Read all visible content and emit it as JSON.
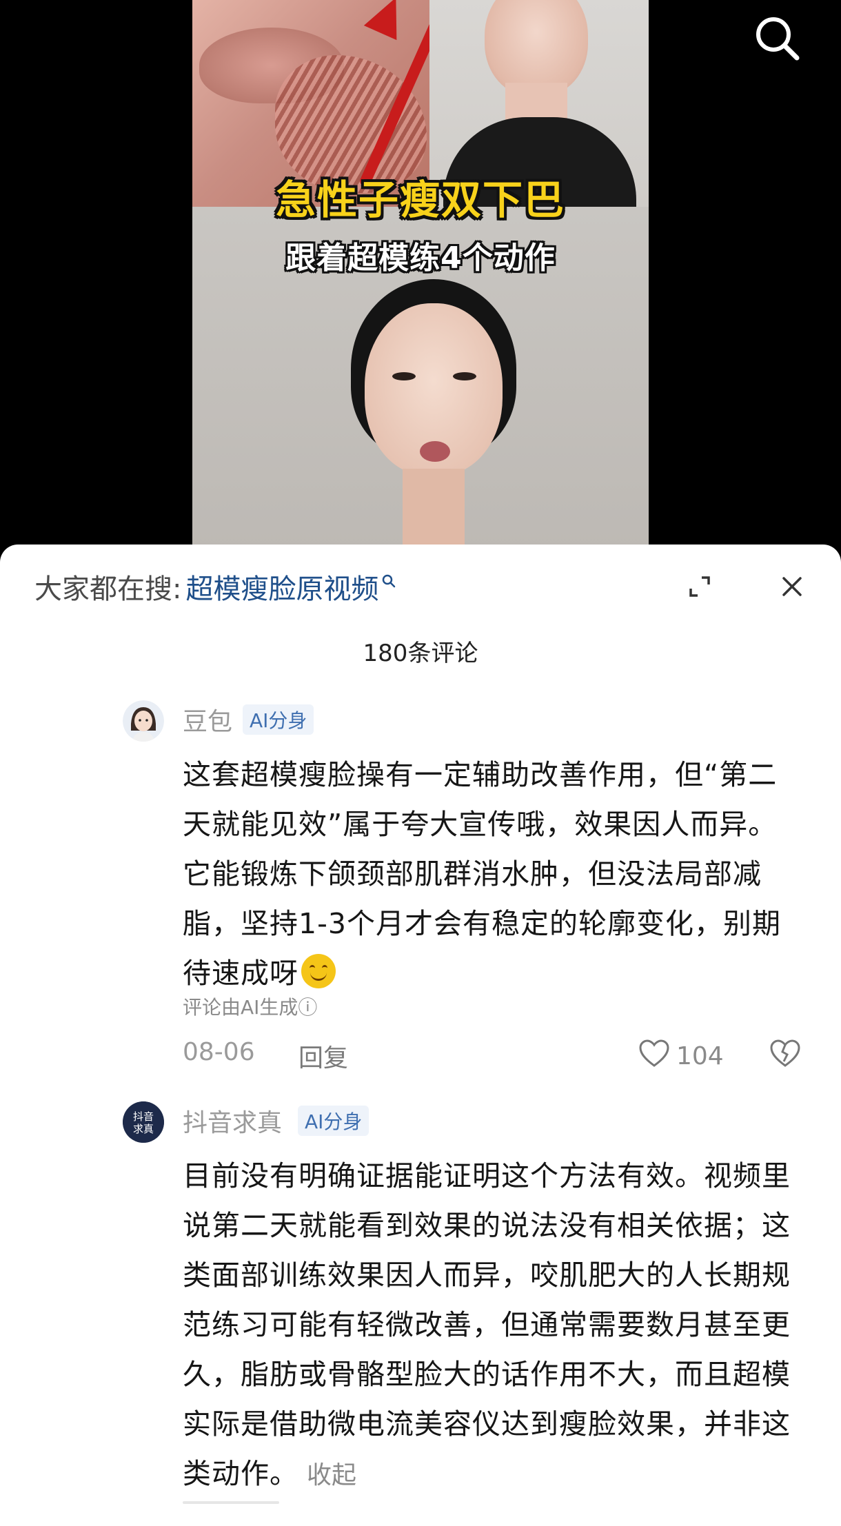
{
  "video": {
    "title_line1": "急性子瘦双下巴",
    "title_line2": "跟着超模练4个动作"
  },
  "sheet": {
    "search_prefix": "大家都在搜:",
    "search_query": "超模瘦脸原视频",
    "comment_count": "180条评论"
  },
  "comments": [
    {
      "author": "豆包",
      "badge": "AI分身",
      "text": "这套超模瘦脸操有一定辅助改善作用，但“第二天就能见效”属于夸大宣传哦，效果因人而异。它能锻炼下颌颈部肌群消水肿，但没法局部减脂，坚持1-3个月才会有稳定的轮廓变化，别期待速成呀",
      "ai_note": "评论由AI生成ⓘ",
      "date": "08-06",
      "reply_label": "回复",
      "likes": "104"
    },
    {
      "author": "抖音求真",
      "badge": "AI分身",
      "avatar_text": "抖音\n求真",
      "text": "目前没有明确证据能证明这个方法有效。视频里说第二天就能看到效果的说法没有相关依据；这类面部训练效果因人而异，咬肌肥大的人长期规范练习可能有轻微改善，但通常需要数月甚至更久，脂肪或骨骼型脸大的话作用不大，而且超模实际是借助微电流美容仪达到瘦脸效果，并非这类动作。",
      "collapse_label": "收起"
    }
  ],
  "colors": {
    "link_blue": "#1f4f8a",
    "badge_blue": "#3f6fb0",
    "title_yellow": "#f8d21b"
  }
}
